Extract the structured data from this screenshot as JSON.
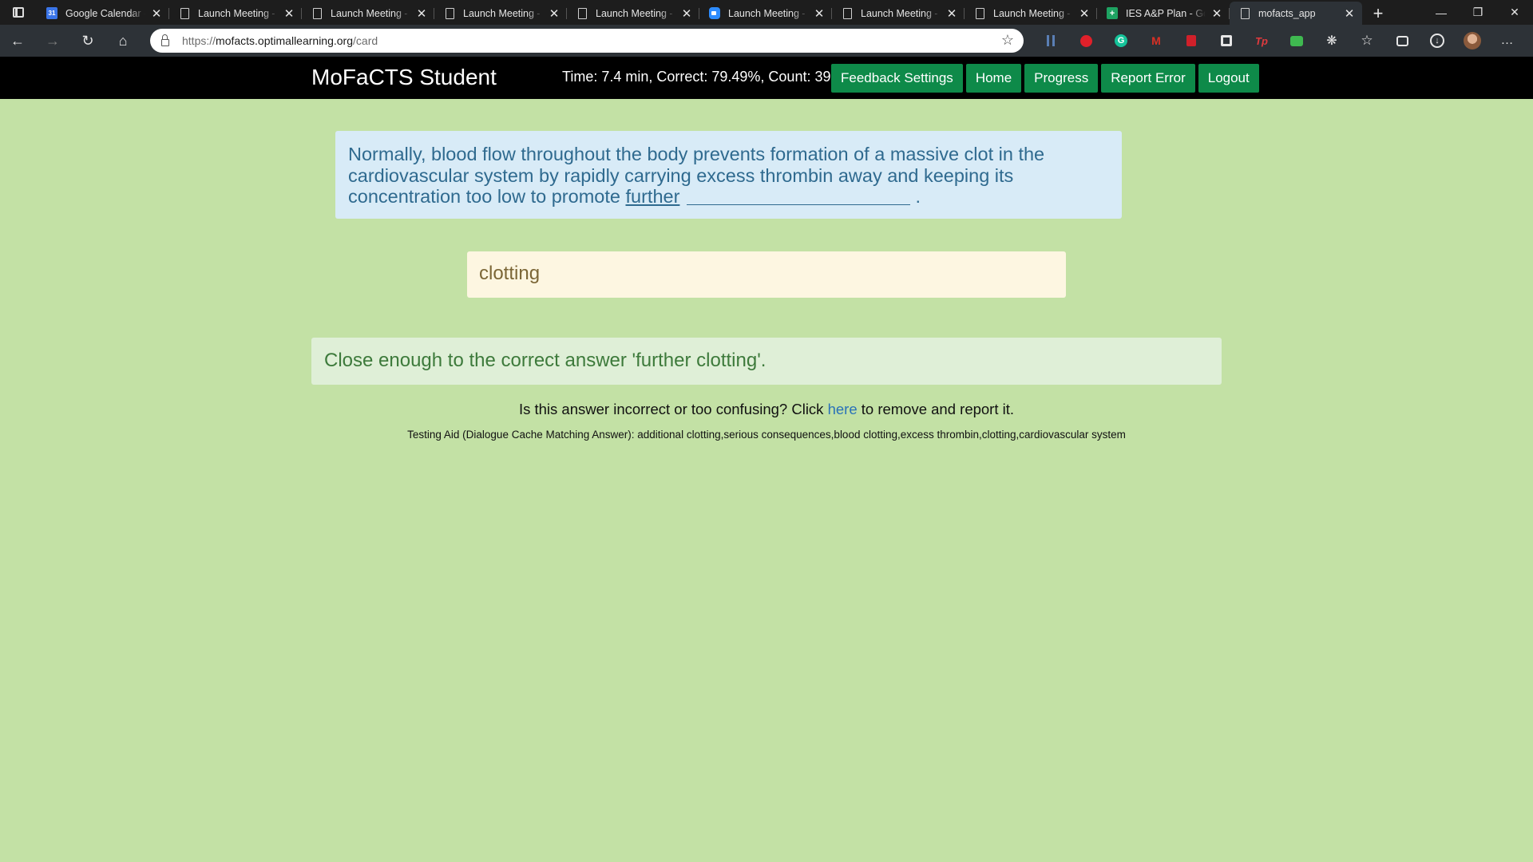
{
  "browser": {
    "tabs": [
      {
        "title": "Google Calendar - ",
        "icon": "calendar-icon",
        "active": false
      },
      {
        "title": "Launch Meeting - ",
        "icon": "document-icon",
        "active": false
      },
      {
        "title": "Launch Meeting - ",
        "icon": "document-icon",
        "active": false
      },
      {
        "title": "Launch Meeting - ",
        "icon": "document-icon",
        "active": false
      },
      {
        "title": "Launch Meeting - ",
        "icon": "document-icon",
        "active": false
      },
      {
        "title": "Launch Meeting - ",
        "icon": "zoom-icon",
        "active": false
      },
      {
        "title": "Launch Meeting - ",
        "icon": "document-icon",
        "active": false
      },
      {
        "title": "Launch Meeting - ",
        "icon": "document-icon",
        "active": false
      },
      {
        "title": "IES A&P Plan - Goo",
        "icon": "sheets-icon",
        "active": false
      },
      {
        "title": "mofacts_app",
        "icon": "document-icon",
        "active": true
      }
    ],
    "address": {
      "scheme": "https://",
      "host": "mofacts.optimallearning.org",
      "path": "/card"
    }
  },
  "app": {
    "title": "MoFaCTS Student",
    "stats": "Time: 7.4 min, Correct: 79.49%, Count: 39",
    "nav": {
      "feedback_settings": "Feedback Settings",
      "home": "Home",
      "progress": "Progress",
      "report_error": "Report Error",
      "logout": "Logout"
    },
    "accent_color": "#0e8a49"
  },
  "card": {
    "question_text": "Normally, blood flow throughout the body prevents formation of a massive clot in the cardiovascular system by rapidly carrying excess thrombin away and keeping its concentration too low to promote",
    "question_underlined": "further",
    "question_end": ".",
    "answer_value": "clotting",
    "feedback": "Close enough to the correct answer 'further clotting'.",
    "report_prefix": "Is this answer incorrect or too confusing? Click",
    "report_link": "here",
    "report_suffix": "to remove and report it.",
    "testing_aid": "Testing Aid (Dialogue Cache Matching Answer): additional clotting,serious consequences,blood clotting,excess thrombin,clotting,cardiovascular system"
  }
}
